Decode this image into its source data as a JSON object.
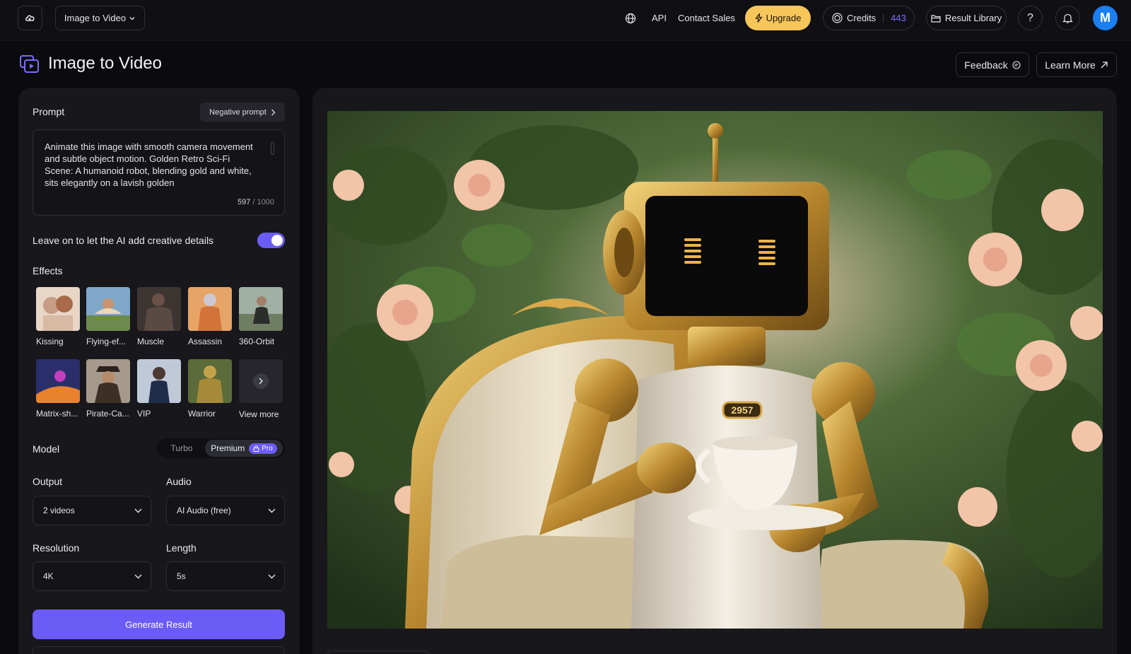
{
  "topbar": {
    "mode_label": "Image to Video",
    "api_label": "API",
    "contact_label": "Contact Sales",
    "upgrade_label": "Upgrade",
    "credits_label": "Credits",
    "credits_count": "443",
    "result_library_label": "Result Library",
    "help_label": "?",
    "avatar_initial": "M"
  },
  "header": {
    "title": "Image to Video",
    "feedback_label": "Feedback",
    "learn_more_label": "Learn More"
  },
  "prompt": {
    "label": "Prompt",
    "negative_label": "Negative prompt",
    "text": "Animate this image with smooth camera movement and subtle object motion. Golden Retro Sci-Fi Scene: A humanoid robot, blending gold and white, sits elegantly on a lavish golden",
    "count": "597",
    "max": " / 1000"
  },
  "creative": {
    "label": "Leave on to let the AI add creative details",
    "enabled": true
  },
  "effects": {
    "label": "Effects",
    "items": [
      {
        "label": "Kissing",
        "color": "#c79c86"
      },
      {
        "label": "Flying-ef...",
        "color": "#7fa7c9"
      },
      {
        "label": "Muscle",
        "color": "#5a4a44"
      },
      {
        "label": "Assassin",
        "color": "#d2743a"
      },
      {
        "label": "360-Orbit",
        "color": "#6f7d62"
      },
      {
        "label": "Matrix-sh...",
        "color": "#6a4da8"
      },
      {
        "label": "Pirate-Ca...",
        "color": "#8b7b6a"
      },
      {
        "label": "VIP",
        "color": "#8fa6c2"
      },
      {
        "label": "Warrior",
        "color": "#7c8a3c"
      }
    ],
    "view_more_label": "View more"
  },
  "model": {
    "label": "Model",
    "turbo_label": "Turbo",
    "premium_label": "Premium",
    "pro_label": "Pro",
    "selected": "Premium"
  },
  "output": {
    "label": "Output",
    "value": "2 videos"
  },
  "audio": {
    "label": "Audio",
    "value": "AI Audio (free)"
  },
  "resolution": {
    "label": "Resolution",
    "value": "4K"
  },
  "length": {
    "label": "Length",
    "value": "5s"
  },
  "generate_label": "Generate Result",
  "preview": {
    "badge_text": "2957"
  },
  "colors": {
    "accent": "#6b5cf5",
    "upgrade": "#f7c65a",
    "avatar": "#1a7ff0"
  }
}
